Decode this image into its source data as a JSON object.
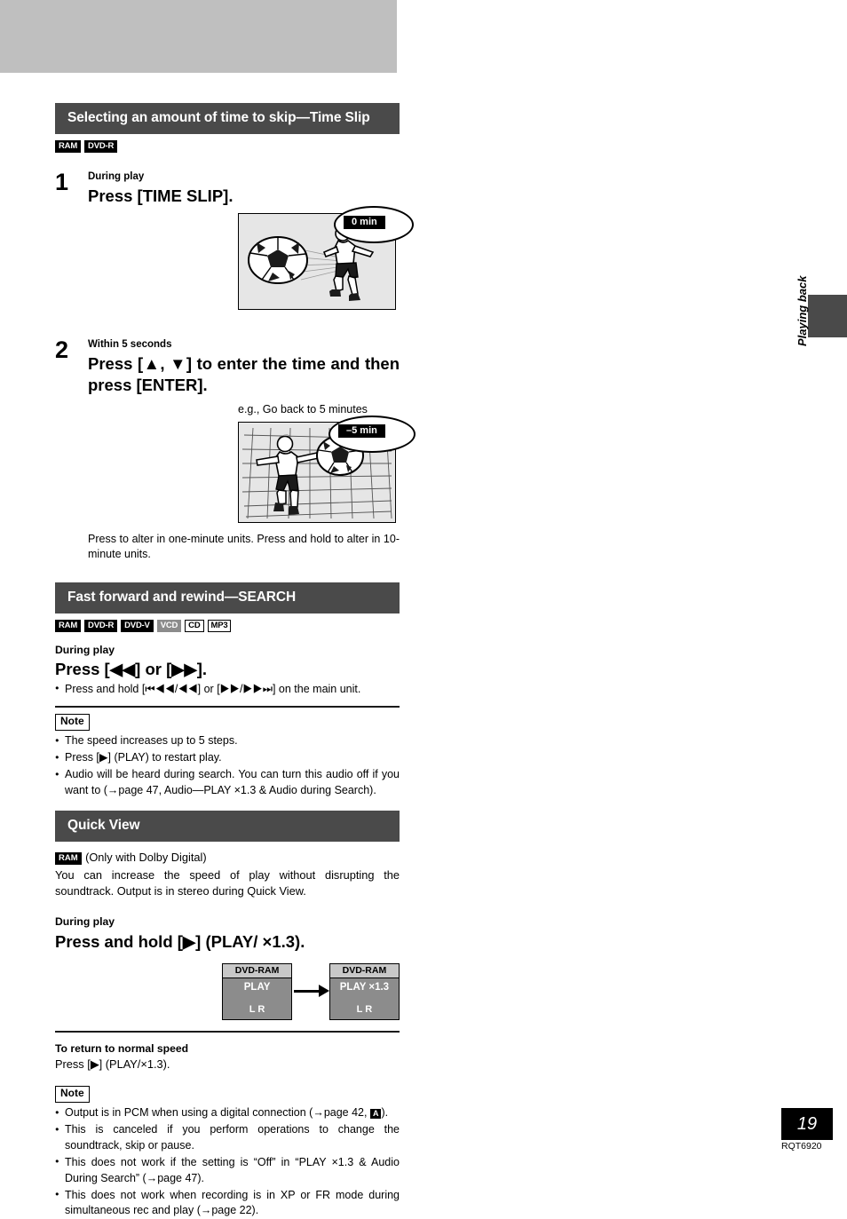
{
  "page": {
    "number": "19",
    "doc_code": "RQT6920",
    "side_tab_label": "Playing back"
  },
  "sections": [
    {
      "id": "time-slip",
      "title": "Selecting an amount of time to skip—Time Slip",
      "badges": [
        {
          "label": "RAM",
          "style": "black"
        },
        {
          "label": "DVD-R",
          "style": "black"
        }
      ],
      "steps": [
        {
          "num": "1",
          "lead": "During play",
          "main": "Press [TIME SLIP].",
          "figure": {
            "name": "soccer-kick-figure",
            "callout": "0 min"
          }
        },
        {
          "num": "2",
          "lead": "Within 5 seconds",
          "main": "Press [▲, ▼] to enter the time and then press [ENTER].",
          "eg_label": "e.g.,  Go back to 5 minutes",
          "figure": {
            "name": "goal-net-figure",
            "callout": "–5 min"
          },
          "caption": "Press to alter in one-minute units. Press and hold to alter in 10-minute units."
        }
      ]
    },
    {
      "id": "search",
      "title": "Fast forward and rewind—SEARCH",
      "badges": [
        {
          "label": "RAM",
          "style": "black"
        },
        {
          "label": "DVD-R",
          "style": "black"
        },
        {
          "label": "DVD-V",
          "style": "black"
        },
        {
          "label": "VCD",
          "style": "gray"
        },
        {
          "label": "CD",
          "style": "white"
        },
        {
          "label": "MP3",
          "style": "white"
        }
      ],
      "lead": "During play",
      "command": "Press [◀◀] or [▶▶].",
      "bullets": [
        "Press and hold [⏮◀◀/◀◀] or [▶▶/▶▶⏭] on the main unit."
      ],
      "note": {
        "tag": "Note",
        "items": [
          "The speed increases up to 5 steps.",
          "Press [▶] (PLAY) to restart play.",
          "Audio will be heard during search. You can turn this audio off if you want to (→page 47, Audio—PLAY ×1.3 & Audio during Search)."
        ]
      }
    },
    {
      "id": "quick-view",
      "title": "Quick View",
      "badge": {
        "label": "RAM",
        "style": "black"
      },
      "badge_note": "(Only with Dolby Digital)",
      "intro": "You can increase the speed of play without disrupting the soundtrack. Output is in stereo during Quick View.",
      "lead": "During play",
      "command": "Press and hold [▶] (PLAY/ ×1.3).",
      "display_demo": {
        "left_box": {
          "header": "DVD-RAM",
          "line1": "PLAY",
          "line2": "L R"
        },
        "right_box": {
          "header": "DVD-RAM",
          "line1": "PLAY ×1.3",
          "line2": "L R"
        }
      },
      "return_heading": "To return to normal speed",
      "return_text": "Press [▶] (PLAY/×1.3).",
      "note": {
        "tag": "Note",
        "items": [
          {
            "pre": "Output is in PCM when using a digital connection (→page 42, ",
            "badge": "A",
            "post": ")."
          },
          {
            "pre": "This is canceled if you perform operations to change the soundtrack, skip or pause.",
            "badge": null,
            "post": ""
          },
          {
            "pre": "This does not work if the setting is “Off” in “PLAY ×1.3 & Audio During Search” (→page 47).",
            "badge": null,
            "post": ""
          },
          {
            "pre": "This does not work when recording is in XP or FR mode during simultaneous rec and play (→page 22).",
            "badge": null,
            "post": ""
          }
        ]
      }
    }
  ]
}
